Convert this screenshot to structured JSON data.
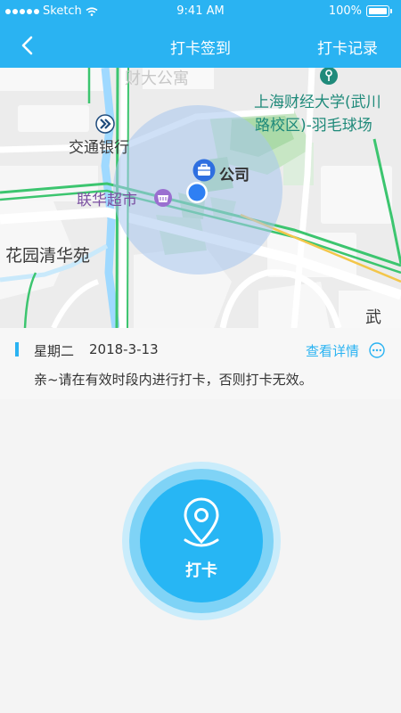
{
  "status_bar": {
    "carrier": "Sketch",
    "time": "9:41 AM",
    "battery": "100%"
  },
  "nav": {
    "title": "打卡签到",
    "right_label": "打卡记录"
  },
  "map": {
    "poi": {
      "bank": "交通银行",
      "supermarket": "联华超市",
      "company": "公司",
      "university_line1": "上海财经大学(武川",
      "university_line2": "路校区)-羽毛球场",
      "garden": "花园清华苑",
      "top_faded": "财大公寓",
      "edge_road": "武"
    }
  },
  "info": {
    "weekday": "星期二",
    "date": "2018-3-13",
    "detail_link": "查看详情",
    "message": "亲~请在有效时段内进行打卡，否则打卡无效。"
  },
  "checkin": {
    "label": "打卡"
  },
  "colors": {
    "primary": "#2ab3f2",
    "map_bg": "#ededed",
    "route_green": "#3cc56f"
  }
}
